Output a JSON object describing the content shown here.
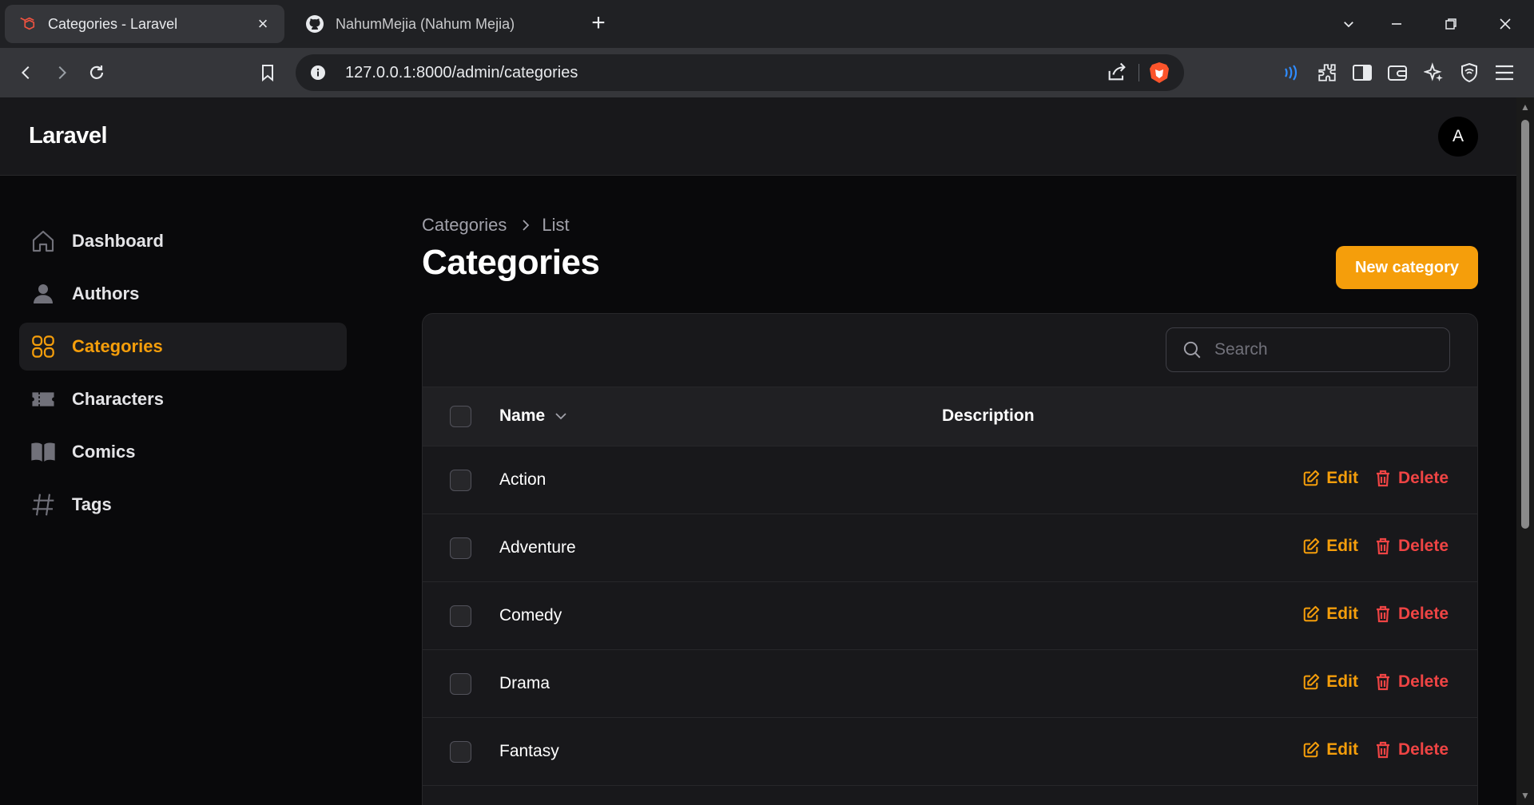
{
  "browser": {
    "tabs": [
      {
        "title": "Categories - Laravel",
        "active": true
      },
      {
        "title": "NahumMejia (Nahum Mejia)",
        "active": false
      }
    ],
    "new_tab": "+",
    "address": "127.0.0.1:8000/admin/categories"
  },
  "app": {
    "brand": "Laravel",
    "avatar_initial": "A",
    "sidebar": {
      "items": [
        {
          "label": "Dashboard",
          "icon": "home-icon",
          "active": false
        },
        {
          "label": "Authors",
          "icon": "user-icon",
          "active": false
        },
        {
          "label": "Categories",
          "icon": "grid-icon",
          "active": true
        },
        {
          "label": "Characters",
          "icon": "ticket-icon",
          "active": false
        },
        {
          "label": "Comics",
          "icon": "book-icon",
          "active": false
        },
        {
          "label": "Tags",
          "icon": "hashtag-icon",
          "active": false
        }
      ]
    },
    "breadcrumb": {
      "root": "Categories",
      "current": "List"
    },
    "page_title": "Categories",
    "new_button": "New category",
    "search_placeholder": "Search",
    "table": {
      "columns": {
        "name": "Name",
        "description": "Description"
      },
      "rows": [
        {
          "name": "Action"
        },
        {
          "name": "Adventure"
        },
        {
          "name": "Comedy"
        },
        {
          "name": "Drama"
        },
        {
          "name": "Fantasy"
        }
      ],
      "edit_label": "Edit",
      "delete_label": "Delete"
    }
  },
  "colors": {
    "accent": "#f59e0b",
    "danger": "#ef4444",
    "background": "#09090b",
    "surface": "#18181b"
  }
}
